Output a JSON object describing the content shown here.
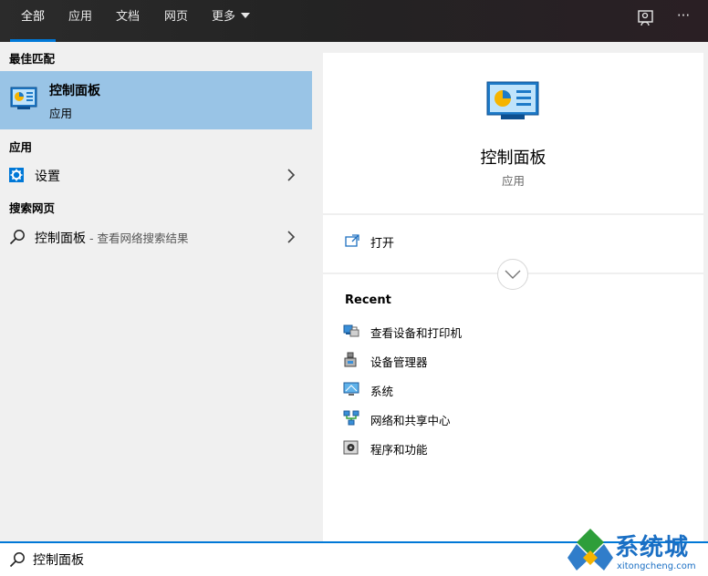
{
  "tabs": [
    {
      "label": "全部",
      "active": true
    },
    {
      "label": "应用",
      "active": false
    },
    {
      "label": "文档",
      "active": false
    },
    {
      "label": "网页",
      "active": false
    },
    {
      "label": "更多",
      "active": false
    }
  ],
  "top_icons": [
    "feedback-icon",
    "more-options-icon"
  ],
  "top_icons_more_label": "···",
  "left": {
    "best_match_heading": "最佳匹配",
    "best_match": {
      "title": "控制面板",
      "subtitle": "应用",
      "icon": "control-panel-icon"
    },
    "apps_heading": "应用",
    "apps": [
      {
        "label": "设置",
        "icon": "settings-gear-icon"
      }
    ],
    "web_heading": "搜索网页",
    "web": [
      {
        "label": "控制面板",
        "hint": " - 查看网络搜索结果",
        "icon": "search-icon"
      }
    ]
  },
  "preview": {
    "title": "控制面板",
    "subtitle": "应用",
    "open_label": "打开",
    "recent_heading": "Recent",
    "recent": [
      {
        "label": "查看设备和打印机",
        "icon": "devices-printers-icon"
      },
      {
        "label": "设备管理器",
        "icon": "device-manager-icon"
      },
      {
        "label": "系统",
        "icon": "system-icon"
      },
      {
        "label": "网络和共享中心",
        "icon": "network-sharing-icon"
      },
      {
        "label": "程序和功能",
        "icon": "programs-features-icon"
      }
    ]
  },
  "search": {
    "value": "控制面板",
    "icon": "search-icon"
  },
  "watermark": {
    "text": "系统城",
    "url": "xitongcheng.com"
  },
  "colors": {
    "accent": "#0078d7",
    "selected": "#99c4e6",
    "topbar": "#2b2b2b",
    "pane": "#f0f0f0"
  }
}
